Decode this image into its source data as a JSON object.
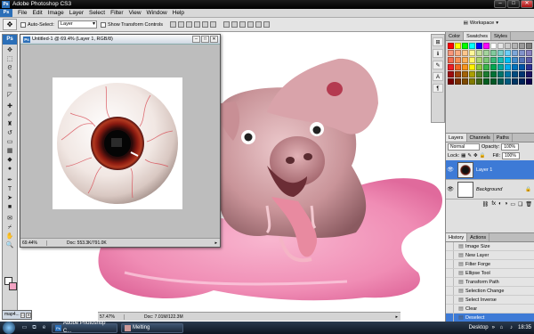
{
  "app": {
    "title": "Adobe Photoshop CS3",
    "logo": "Ps"
  },
  "menu": [
    "File",
    "Edit",
    "Image",
    "Layer",
    "Select",
    "Filter",
    "View",
    "Window",
    "Help"
  ],
  "options": {
    "auto_select_label": "Auto-Select:",
    "auto_select_value": "Layer",
    "transform_label": "Show Transform Controls",
    "workspace_label": "Workspace"
  },
  "document": {
    "title": "Untitled-1 @ 69.4% (Layer 1, RGB/8)",
    "zoom": "69.44%",
    "doc_info": "Doc: 553.3K/791.0K"
  },
  "main_status": {
    "zoom": "57.47%",
    "doc_info": "Doc: 7.01M/122.3M"
  },
  "swatch_panel": {
    "tabs": [
      "Color",
      "Swatches",
      "Styles"
    ],
    "active_tab": "Swatches",
    "colors": [
      "#ff0000",
      "#ffff00",
      "#00ff00",
      "#00ffff",
      "#0000ff",
      "#ff00ff",
      "#ffffff",
      "#e6e6e6",
      "#cccccc",
      "#b3b3b3",
      "#999999",
      "#808080",
      "#f7977a",
      "#fbad82",
      "#fdc68c",
      "#fff799",
      "#c6df9c",
      "#a4d49d",
      "#81ca9d",
      "#7bcdc9",
      "#6ccff7",
      "#7ca6d8",
      "#8293ca",
      "#8881be",
      "#f26c4f",
      "#f68e55",
      "#fbaf5a",
      "#fff467",
      "#acd372",
      "#7cc576",
      "#3bb878",
      "#1abbb4",
      "#00bff3",
      "#438ccb",
      "#5573b7",
      "#5e5ca7",
      "#ed1c24",
      "#f26522",
      "#f7941d",
      "#fff200",
      "#8dc63f",
      "#39b54a",
      "#00a651",
      "#00a99d",
      "#00aeef",
      "#0072bc",
      "#0054a6",
      "#2e3192",
      "#9e0b0f",
      "#a0410d",
      "#a36209",
      "#aba000",
      "#598527",
      "#1a7b30",
      "#007236",
      "#00746b",
      "#0076a3",
      "#004b80",
      "#003471",
      "#1b1464",
      "#790000",
      "#7b2e00",
      "#7d4900",
      "#827b00",
      "#406618",
      "#005e20",
      "#005826",
      "#005952",
      "#005b7f",
      "#003663",
      "#002157",
      "#0d004c"
    ]
  },
  "layers_panel": {
    "tabs": [
      "Layers",
      "Channels",
      "Paths"
    ],
    "blend_mode": "Normal",
    "opacity_label": "Opacity:",
    "opacity_value": "100%",
    "lock_label": "Lock:",
    "fill_label": "Fill:",
    "fill_value": "100%",
    "layers": [
      {
        "name": "Layer 1",
        "active": true
      },
      {
        "name": "Background",
        "active": false
      }
    ]
  },
  "history_panel": {
    "tabs": [
      "History",
      "Actions"
    ],
    "items": [
      "Image Size",
      "New Layer",
      "Filter Forge",
      "Ellipse Tool",
      "Transform Path",
      "Selection Change",
      "Select Inverse",
      "Clear",
      "Deselect"
    ],
    "active_index": 8
  },
  "minimized_doc": {
    "title": "map4..."
  },
  "taskbar": {
    "tasks": [
      "Adobe Photoshop C...",
      "Melting"
    ],
    "desktop_label": "Desktop",
    "clock": "18:35"
  }
}
